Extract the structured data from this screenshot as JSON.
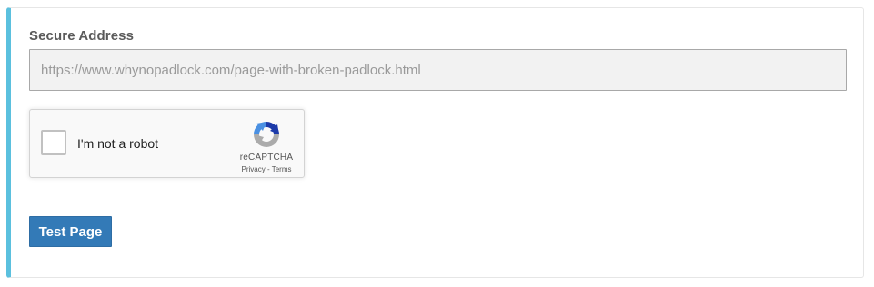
{
  "form": {
    "label": "Secure Address",
    "url_value": "https://www.whynopadlock.com/page-with-broken-padlock.html",
    "submit_label": "Test Page"
  },
  "recaptcha": {
    "label": "I'm not a robot",
    "brand": "reCAPTCHA",
    "privacy": "Privacy",
    "separator": " - ",
    "terms": "Terms",
    "icon": "recaptcha-logo-icon",
    "checked": false
  },
  "colors": {
    "card_accent": "#5bc0de",
    "button": "#337ab7",
    "input_bg": "#f2f2f2",
    "recaptcha_blue_dark": "#1c3aa9",
    "recaptcha_blue": "#4a90e2",
    "recaptcha_grey": "#ababab"
  }
}
